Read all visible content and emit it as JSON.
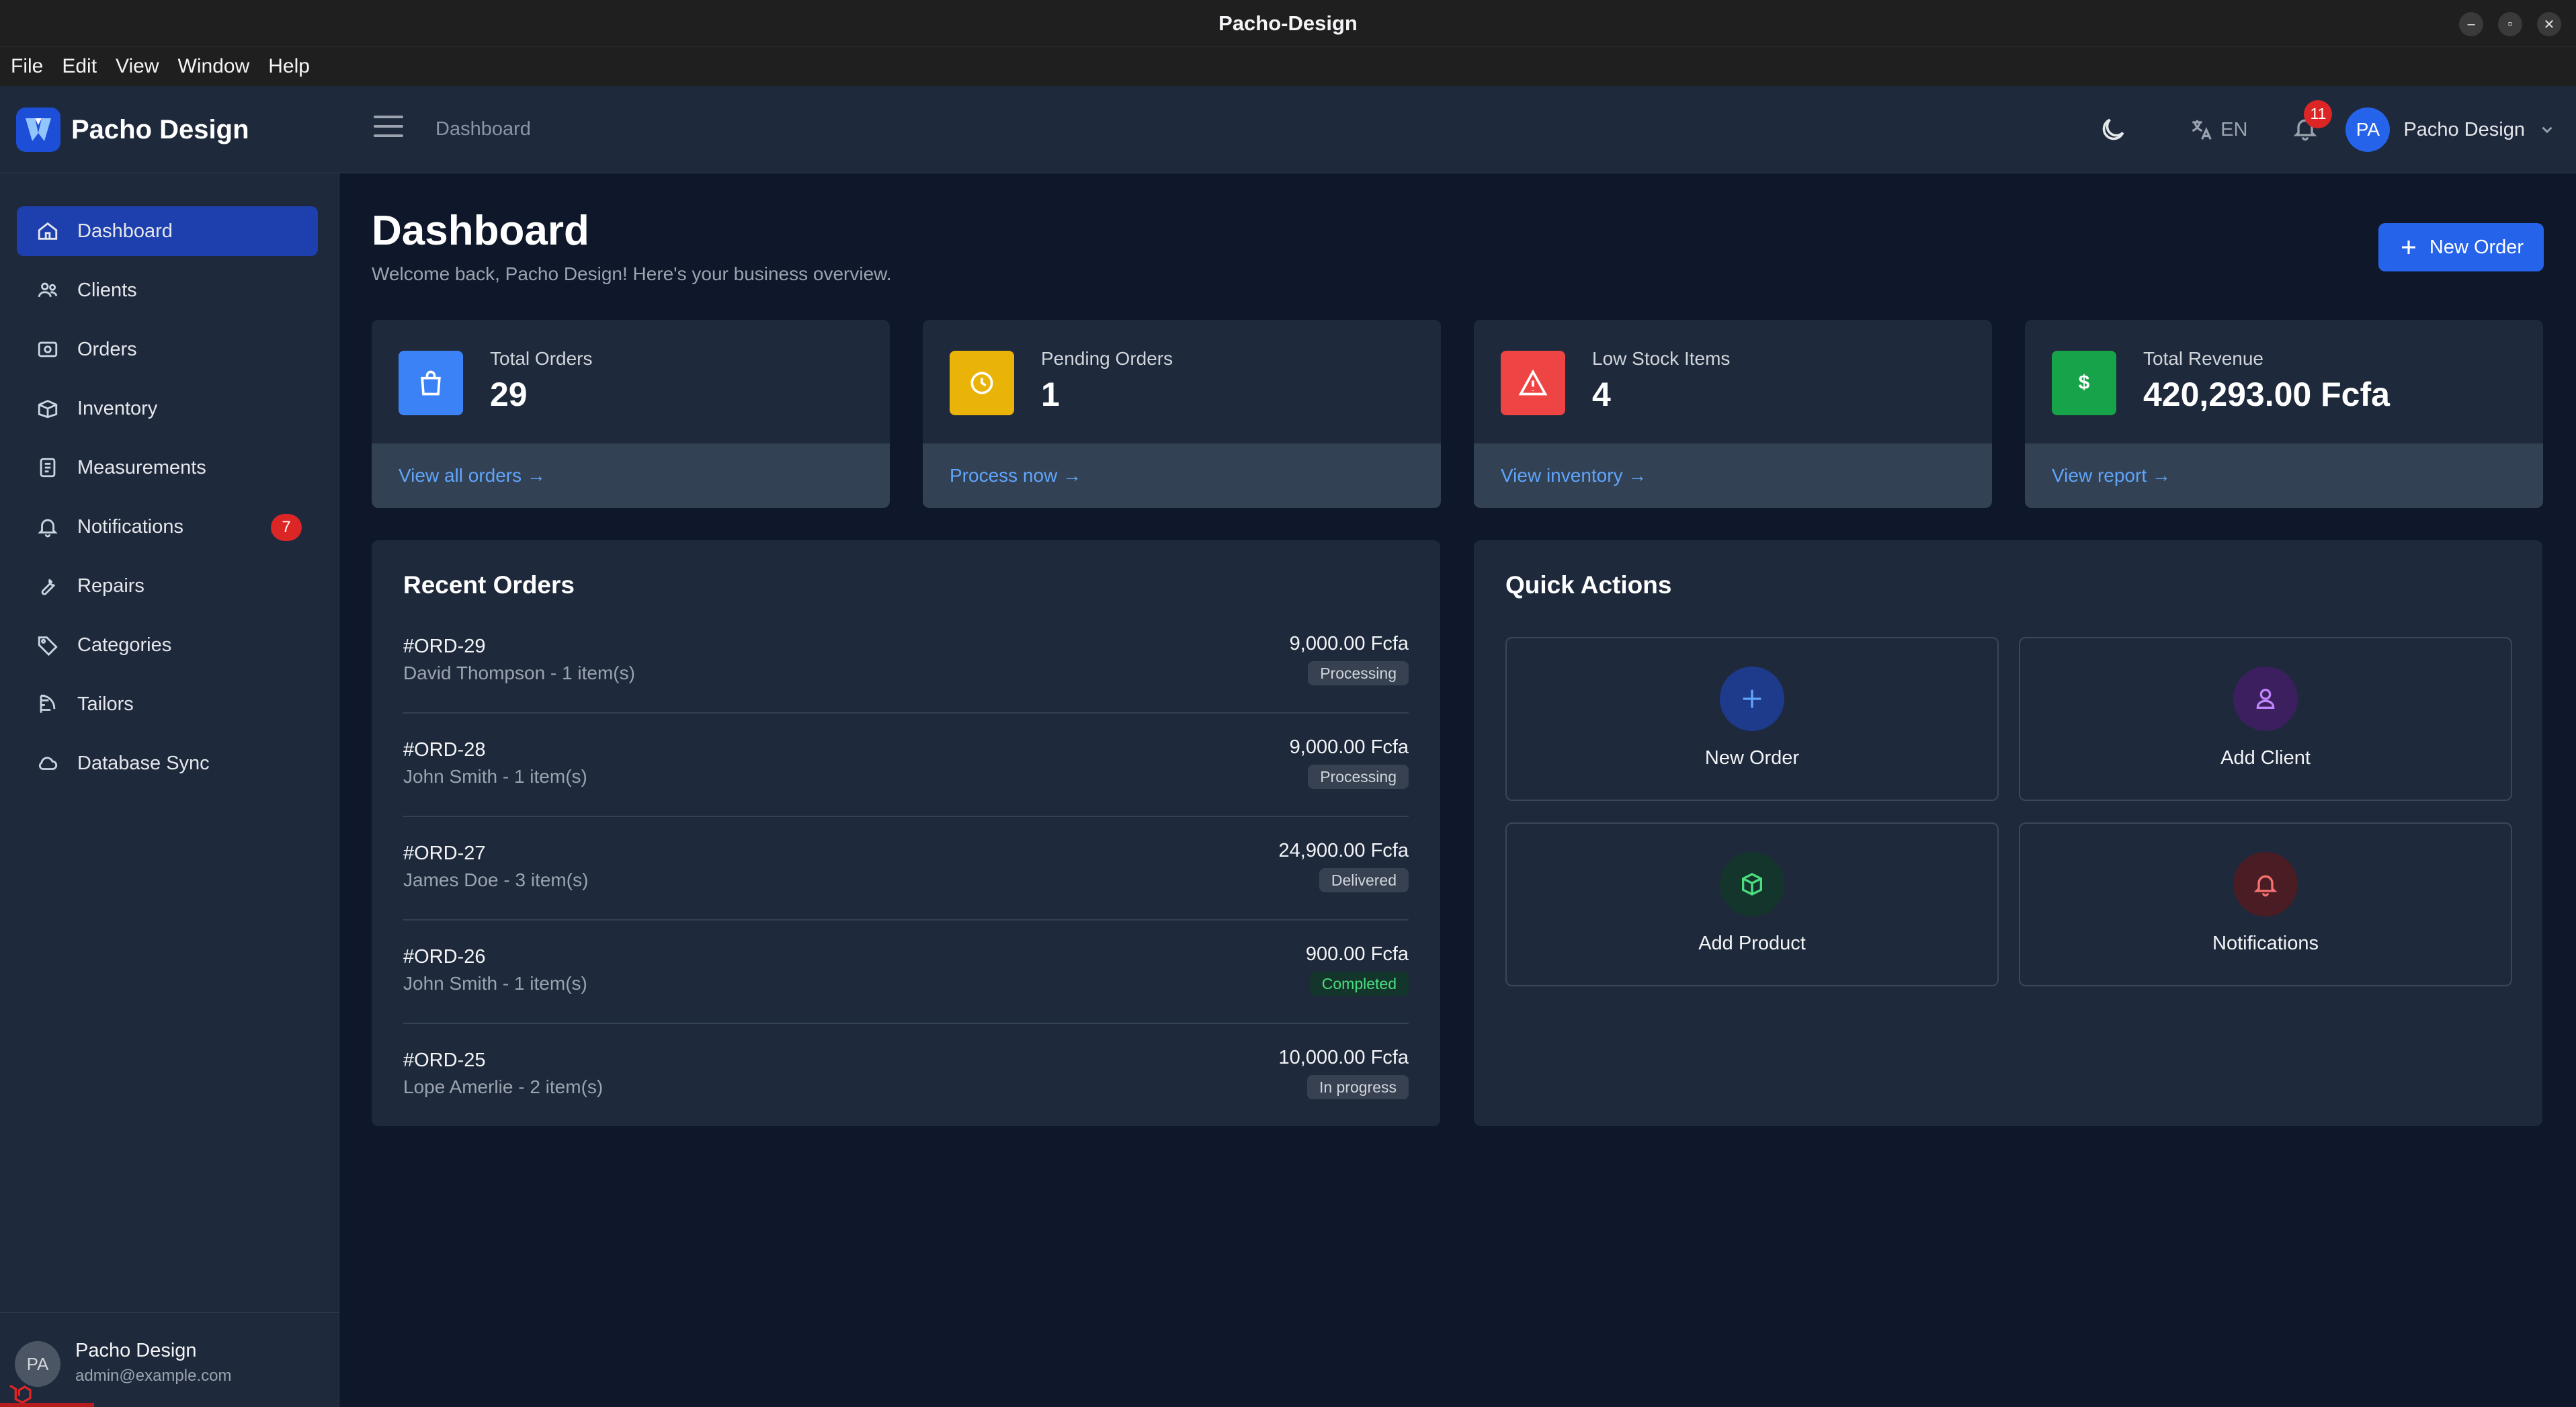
{
  "window": {
    "title": "Pacho-Design"
  },
  "menu": [
    "File",
    "Edit",
    "View",
    "Window",
    "Help"
  ],
  "header": {
    "brand": "Pacho Design",
    "breadcrumb": "Dashboard",
    "language": "EN",
    "notification_count": "11",
    "user_initials": "PA",
    "user_name": "Pacho Design"
  },
  "sidebar": {
    "items": [
      {
        "label": "Dashboard",
        "icon": "home-icon",
        "active": true
      },
      {
        "label": "Clients",
        "icon": "users-icon"
      },
      {
        "label": "Orders",
        "icon": "orders-icon"
      },
      {
        "label": "Inventory",
        "icon": "inventory-icon"
      },
      {
        "label": "Measurements",
        "icon": "clipboard-icon"
      },
      {
        "label": "Notifications",
        "icon": "bell-icon",
        "badge": "7"
      },
      {
        "label": "Repairs",
        "icon": "wrench-icon"
      },
      {
        "label": "Categories",
        "icon": "tag-icon"
      },
      {
        "label": "Tailors",
        "icon": "ruler-icon"
      },
      {
        "label": "Database Sync",
        "icon": "cloud-icon"
      }
    ],
    "footer": {
      "initials": "PA",
      "name": "Pacho Design",
      "email": "admin@example.com"
    }
  },
  "page": {
    "title": "Dashboard",
    "subtitle": "Welcome back, Pacho Design! Here's your business overview.",
    "new_order_label": "New Order"
  },
  "stats": [
    {
      "label": "Total Orders",
      "value": "29",
      "link": "View all orders →",
      "color": "#3b82f6",
      "icon": "shopping-bag-icon"
    },
    {
      "label": "Pending Orders",
      "value": "1",
      "link": "Process now →",
      "color": "#eab308",
      "icon": "clock-icon"
    },
    {
      "label": "Low Stock Items",
      "value": "4",
      "link": "View inventory →",
      "color": "#ef4444",
      "icon": "warning-icon"
    },
    {
      "label": "Total Revenue",
      "value": "420,293.00 Fcfa",
      "link": "View report →",
      "color": "#16a34a",
      "icon": "dollar-icon"
    }
  ],
  "recent_orders": {
    "title": "Recent Orders",
    "rows": [
      {
        "id": "#ORD-29",
        "customer": "David Thompson - 1 item(s)",
        "amount": "9,000.00 Fcfa",
        "status": "Processing"
      },
      {
        "id": "#ORD-28",
        "customer": "John Smith - 1 item(s)",
        "amount": "9,000.00 Fcfa",
        "status": "Processing"
      },
      {
        "id": "#ORD-27",
        "customer": "James Doe - 3 item(s)",
        "amount": "24,900.00 Fcfa",
        "status": "Delivered"
      },
      {
        "id": "#ORD-26",
        "customer": "John Smith - 1 item(s)",
        "amount": "900.00 Fcfa",
        "status": "Completed"
      },
      {
        "id": "#ORD-25",
        "customer": "Lope Amerlie - 2 item(s)",
        "amount": "10,000.00 Fcfa",
        "status": "In progress"
      }
    ]
  },
  "quick_actions": {
    "title": "Quick Actions",
    "items": [
      {
        "label": "New Order",
        "icon": "plus-icon",
        "color": "#3b82f6"
      },
      {
        "label": "Add Client",
        "icon": "user-icon",
        "color": "#a855f7"
      },
      {
        "label": "Add Product",
        "icon": "cube-icon",
        "color": "#22c55e"
      },
      {
        "label": "Notifications",
        "icon": "bell-icon",
        "color": "#ef4444"
      }
    ]
  }
}
